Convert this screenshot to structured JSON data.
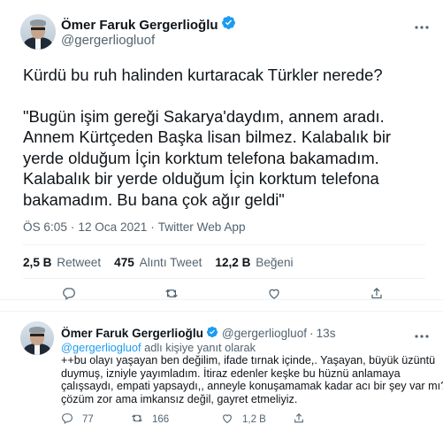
{
  "main_tweet": {
    "author_name": "Ömer Faruk Gergerlioğlu",
    "author_handle": "@gergerliogluof",
    "text_lines_1": [
      "Kürdü bu ruh halinden kurtaracak Türkler nerede?"
    ],
    "text_lines_2": [
      "\"Bugün işim gereği Sakarya'daydım, annem aradı.",
      "Annem Kürtçeden Başka lisan bilmez. Kalabalık bir",
      "yerde olduğum İçin korktum telefona bakamadım.",
      "Kalabalık bir yerde olduğum İçin korktum telefona",
      "bakamadım. Bu bana çok ağır geldi\""
    ],
    "time": "ÖS 6:05",
    "date": "12 Oca 2021",
    "source": "Twitter Web App",
    "separator": "·",
    "stats": {
      "retweets_value": "2,5 B",
      "retweets_label": "Retweet",
      "quotes_value": "475",
      "quotes_label": "Alıntı Tweet",
      "likes_value": "12,2 B",
      "likes_label": "Beğeni"
    }
  },
  "reply_tweet": {
    "author_name": "Ömer Faruk Gergerlioğlu",
    "author_handle": "@gergerliogluof",
    "dot": "·",
    "time": "13s",
    "replying_link": "@gergerliogluof",
    "replying_suffix": "adlı kişiye yanıt olarak",
    "text_lines": [
      "++bu olayı yaşayan ben değilim, ifade tırnak içinde,. Yaşayan, büyük üzüntü",
      "duymuş, izniyle yayımladım. İtiraz edenler keşke bu hüznü anlamaya",
      "çalışsaydı, empati yapsaydı,,  anneyle konuşamamak kadar acı bir şey var mı?",
      "çözüm zor ama imkansız değil, gayret etmeliyiz."
    ],
    "actions": {
      "reply_count": "77",
      "retweet_count": "166",
      "like_count": "1,2 B"
    }
  },
  "colors": {
    "text_primary": "#0f1419",
    "text_secondary": "#536471",
    "accent": "#1d9bf0",
    "divider": "#eff3f4"
  },
  "icons": [
    "verified-badge-icon",
    "more-icon",
    "reply-icon",
    "retweet-icon",
    "like-icon",
    "share-icon"
  ]
}
